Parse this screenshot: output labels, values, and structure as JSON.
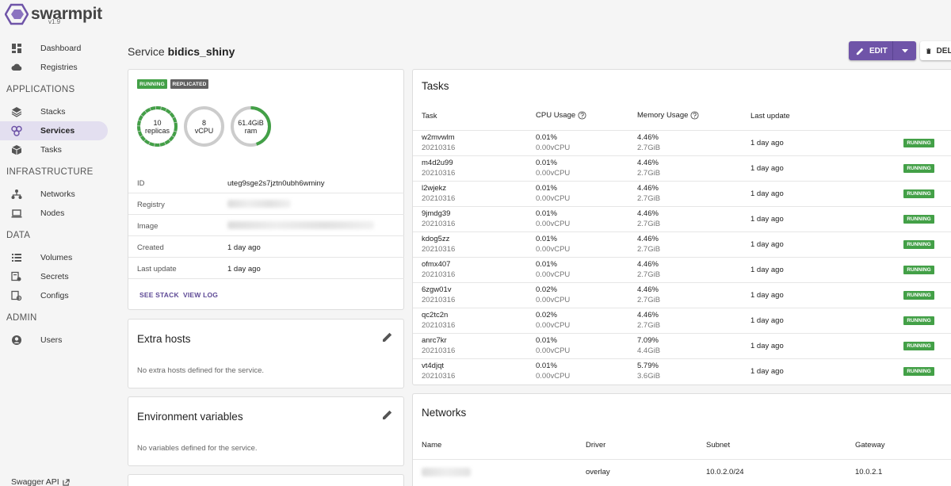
{
  "app": {
    "name": "swarmpit",
    "version": "v1.9"
  },
  "sidebar": {
    "top_items": [
      {
        "label": "Dashboard",
        "icon": "dashboard-icon"
      },
      {
        "label": "Registries",
        "icon": "cloud-icon"
      }
    ],
    "sections": [
      {
        "title": "APPLICATIONS",
        "items": [
          {
            "label": "Stacks",
            "icon": "layers-icon"
          },
          {
            "label": "Services",
            "icon": "services-icon",
            "active": true
          },
          {
            "label": "Tasks",
            "icon": "cube-icon"
          }
        ]
      },
      {
        "title": "INFRASTRUCTURE",
        "items": [
          {
            "label": "Networks",
            "icon": "network-icon"
          },
          {
            "label": "Nodes",
            "icon": "laptop-icon"
          }
        ]
      },
      {
        "title": "DATA",
        "items": [
          {
            "label": "Volumes",
            "icon": "volumes-icon"
          },
          {
            "label": "Secrets",
            "icon": "secrets-icon"
          },
          {
            "label": "Configs",
            "icon": "configs-icon"
          }
        ]
      },
      {
        "title": "ADMIN",
        "items": [
          {
            "label": "Users",
            "icon": "user-icon"
          }
        ]
      }
    ],
    "swagger": "Swagger API"
  },
  "header": {
    "prefix": "Service",
    "service_name": "bidics_shiny",
    "edit_label": "EDIT",
    "delete_label": "DELETE"
  },
  "summary": {
    "badges": [
      "RUNNING",
      "REPLICATED"
    ],
    "rings": [
      {
        "value": "10",
        "label": "replicas",
        "fill": 1.0
      },
      {
        "value": "8",
        "label": "vCPU",
        "fill": 0.0
      },
      {
        "value": "61.4GiB",
        "label": "ram",
        "fill": 0.45
      }
    ],
    "info": [
      {
        "key": "ID",
        "value": "uteg9sge2s7jztn0ubh6wminy"
      },
      {
        "key": "Registry",
        "value": ""
      },
      {
        "key": "Image",
        "value": ""
      },
      {
        "key": "Created",
        "value": "1 day ago"
      },
      {
        "key": "Last update",
        "value": "1 day ago"
      }
    ],
    "see_stack": "SEE STACK",
    "view_log": "VIEW LOG"
  },
  "extra_hosts": {
    "title": "Extra hosts",
    "empty": "No extra hosts defined for the service."
  },
  "env_vars": {
    "title": "Environment variables",
    "empty": "No variables defined for the service."
  },
  "tasks": {
    "title": "Tasks",
    "columns": [
      "Task",
      "CPU Usage",
      "Memory Usage",
      "Last update"
    ],
    "rows": [
      {
        "name": "w2mvwlm",
        "date": "20210316",
        "cpu": "0.01%",
        "vcpu": "0.00vCPU",
        "mem": "4.46%",
        "memsize": "2.7GiB",
        "updated": "1 day ago",
        "status": "RUNNING"
      },
      {
        "name": "m4d2u99",
        "date": "20210316",
        "cpu": "0.01%",
        "vcpu": "0.00vCPU",
        "mem": "4.46%",
        "memsize": "2.7GiB",
        "updated": "1 day ago",
        "status": "RUNNING"
      },
      {
        "name": "l2wjekz",
        "date": "20210316",
        "cpu": "0.01%",
        "vcpu": "0.00vCPU",
        "mem": "4.46%",
        "memsize": "2.7GiB",
        "updated": "1 day ago",
        "status": "RUNNING"
      },
      {
        "name": "9jmdg39",
        "date": "20210316",
        "cpu": "0.01%",
        "vcpu": "0.00vCPU",
        "mem": "4.46%",
        "memsize": "2.7GiB",
        "updated": "1 day ago",
        "status": "RUNNING"
      },
      {
        "name": "kdog5zz",
        "date": "20210316",
        "cpu": "0.01%",
        "vcpu": "0.00vCPU",
        "mem": "4.46%",
        "memsize": "2.7GiB",
        "updated": "1 day ago",
        "status": "RUNNING"
      },
      {
        "name": "ofmx407",
        "date": "20210316",
        "cpu": "0.01%",
        "vcpu": "0.00vCPU",
        "mem": "4.46%",
        "memsize": "2.7GiB",
        "updated": "1 day ago",
        "status": "RUNNING"
      },
      {
        "name": "6zgw01v",
        "date": "20210316",
        "cpu": "0.02%",
        "vcpu": "0.00vCPU",
        "mem": "4.46%",
        "memsize": "2.7GiB",
        "updated": "1 day ago",
        "status": "RUNNING"
      },
      {
        "name": "qc2tc2n",
        "date": "20210316",
        "cpu": "0.02%",
        "vcpu": "0.00vCPU",
        "mem": "4.46%",
        "memsize": "2.7GiB",
        "updated": "1 day ago",
        "status": "RUNNING"
      },
      {
        "name": "anrc7kr",
        "date": "20210316",
        "cpu": "0.01%",
        "vcpu": "0.00vCPU",
        "mem": "7.09%",
        "memsize": "4.4GiB",
        "updated": "1 day ago",
        "status": "RUNNING"
      },
      {
        "name": "vt4djqt",
        "date": "20210316",
        "cpu": "0.01%",
        "vcpu": "0.00vCPU",
        "mem": "5.79%",
        "memsize": "3.6GiB",
        "updated": "1 day ago",
        "status": "RUNNING"
      }
    ]
  },
  "networks": {
    "title": "Networks",
    "columns": [
      "Name",
      "Driver",
      "Subnet",
      "Gateway"
    ],
    "rows": [
      {
        "name": "",
        "driver": "overlay",
        "subnet": "10.0.2.0/24",
        "gateway": "10.0.2.1"
      }
    ]
  },
  "colors": {
    "accent": "#6f54a8",
    "running": "#43a047",
    "replicated": "#616161",
    "active_nav": "#e3dff0"
  }
}
